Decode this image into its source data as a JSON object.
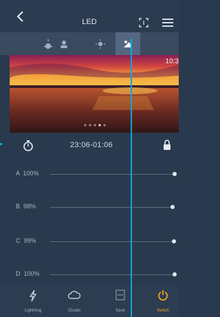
{
  "header": {
    "title": "LED",
    "back_icon": "chevron-left-icon",
    "crop_icon": "crop-frame-icon",
    "menu_icon": "menu-icon"
  },
  "mode_tabs": [
    {
      "name": "sunrise",
      "icon": "sunrise-icon",
      "active": false
    },
    {
      "name": "daylight",
      "icon": "sun-cloud-icon",
      "active": false
    },
    {
      "name": "sun",
      "icon": "sun-icon",
      "active": false
    },
    {
      "name": "sunset",
      "icon": "sunset-icon",
      "active": true
    },
    {
      "name": "moon",
      "icon": "moon-icon",
      "active": false
    }
  ],
  "photo": {
    "description_icon": "sunset-photo",
    "time_text": "10:3",
    "page_count": 5,
    "active_page": 4
  },
  "timer": {
    "time_range": "23:06-01:06",
    "timer_icon": "stopwatch-icon",
    "lock_icon": "lock-icon"
  },
  "channels": [
    {
      "label": "A  100%",
      "value": 100
    },
    {
      "label": "B  98%",
      "value": 98
    },
    {
      "label": "C  99%",
      "value": 99
    },
    {
      "label": "D  100%",
      "value": 100
    }
  ],
  "bottom_nav": [
    {
      "label": "Lightning",
      "icon": "lightning-icon",
      "active": false
    },
    {
      "label": "Clouds",
      "icon": "cloud-icon",
      "active": false
    },
    {
      "label": "Save",
      "icon": "save-icon",
      "active": false
    },
    {
      "label": "Switch",
      "icon": "power-icon",
      "active": true
    }
  ],
  "colors": {
    "accent": "#f2a51b",
    "overlay_line": "#0ba7e0",
    "background": "#2a3a4e"
  }
}
